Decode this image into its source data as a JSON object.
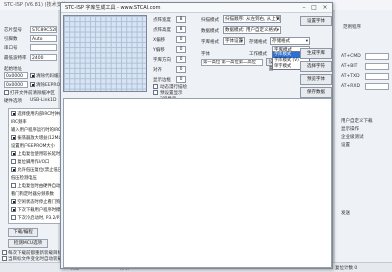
{
  "bg": {
    "title": "STC-ISP (V6.81) (技术支持: www.STCAI.com)",
    "left_labels": [
      "芯片型号",
      "引脚数",
      "串口号",
      "最低波特率",
      "起始地址"
    ],
    "chip_value": "STC89C52RC",
    "pin_value": "Auto",
    "port_value": "",
    "baud_value": "2400",
    "addr1": "0x0000",
    "addr2": "0x0000",
    "clear_code": "清除代码缓冲区",
    "clear_eeprom": "清除EEPROM缓冲区",
    "hex_option": "打开文件前清除缓冲区",
    "hw_option": "硬件选项",
    "hw_tab2": "USB-Link1D",
    "option_rows": [
      "选择使用内部IRC时钟(不选为外部时钟)",
      "IRC频率",
      "输入用户程序运行时的IRC频率",
      "振荡器放大增益(12M以上建议选择)",
      "设置用户EEPROM大小",
      "上电复位使用较长延时",
      "复位脚用作I/O口",
      "允许低压复位(禁止低压中断)",
      "低压检测电压",
      "上电复位时由硬件自动启动看门狗",
      "看门狗定时器分频系数",
      "空闲状态时停止看门狗计数",
      "下次下载用户程序时擦除用户EEPROM区",
      "下次冷启动时, P3.2/P3.3为0/0才可下载程序"
    ],
    "btn_download": "下载/编程",
    "btn_check": "检测MCU选项",
    "bottom_line1": "每次下载前都重新装载目标文件",
    "bottom_line2": "当目标文件变化时自动装载并发送下载命令",
    "right_header": "范例程序",
    "right_labels": [
      "AT+BIT",
      "AT+TXD",
      "AT+RXD",
      "AT+CMD"
    ],
    "right_items": [
      "用户自定义下载",
      "显示操作",
      "企业级测试",
      "设置",
      "发送"
    ],
    "status_text": "发送 0",
    "status_text2": "接收 0",
    "status_right": "复位计数 0"
  },
  "dlg": {
    "title": "STC-ISP 字库生成工具 - www.STCAI.com",
    "labels": {
      "width": "点阵宽度",
      "height": "点阵高度",
      "scan": "扫描模式",
      "data_mode": "数据模式",
      "font_size": "字库格式",
      "storage": "存储格式",
      "work_mode": "工作模式",
      "font": "字体",
      "align": "对齐",
      "x_offset": "X偏移",
      "y_offset": "Y偏移",
      "font_dir": "字库方向",
      "bg": "显示边框",
      "chk_scale": "动态漫行描绘",
      "chk_repeat": "预设置显示",
      "chk_ascii": "2行显示"
    },
    "values": {
      "width": "8",
      "height": "8",
      "scan": "扫描顺序: 从左到右, 从上到下",
      "data_mode": "数据模式: 用户自定义格式",
      "font_size": "字体设置",
      "storage": "存储格式",
      "work_mode": "字库模式",
      "list_text": "第一高位 第一高位第二高位"
    },
    "spin_values": [
      "0",
      "0",
      "0",
      "0",
      "0"
    ],
    "dropdown_options": [
      "字库模式",
      "字库模式 (V)",
      "单字模式"
    ],
    "buttons": [
      "生成字库",
      "选择字符",
      "预览字体",
      "保存数据",
      "退出程序"
    ],
    "top_btn": "设置字体",
    "mini_btn1": "设置",
    "mini_btn2": "选择"
  }
}
